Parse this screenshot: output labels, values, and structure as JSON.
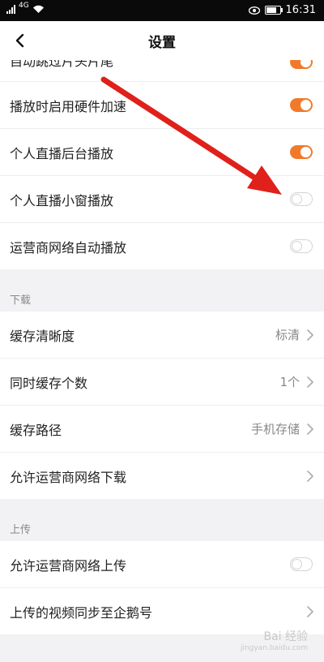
{
  "status_bar": {
    "signal_text": "4G",
    "time": "16:31",
    "icons": [
      "signal-icon",
      "wifi-icon",
      "eye-icon",
      "battery-icon"
    ]
  },
  "nav": {
    "title": "设置",
    "back_icon": "back-arrow-icon"
  },
  "playback": {
    "cut_item": {
      "label": "自动跳过片头片尾",
      "toggle": "on"
    },
    "items": [
      {
        "label": "播放时启用硬件加速",
        "toggle": "on"
      },
      {
        "label": "个人直播后台播放",
        "toggle": "on"
      },
      {
        "label": "个人直播小窗播放",
        "toggle": "off"
      },
      {
        "label": "运营商网络自动播放",
        "toggle": "off"
      }
    ]
  },
  "download": {
    "header": "下载",
    "items": [
      {
        "label": "缓存清晰度",
        "value": "标清"
      },
      {
        "label": "同时缓存个数",
        "value": "1个"
      },
      {
        "label": "缓存路径",
        "value": "手机存储"
      },
      {
        "label": "允许运营商网络下载",
        "value": ""
      }
    ]
  },
  "upload": {
    "header": "上传",
    "items": [
      {
        "label": "允许运营商网络上传",
        "toggle": "off"
      },
      {
        "label": "上传的视频同步至企鹅号",
        "value": ""
      }
    ]
  },
  "colors": {
    "toggle_on": "#f07a2a",
    "annotation_arrow": "#e0201b"
  },
  "watermark": {
    "text": "Bai 经验",
    "sub": "jingyan.baidu.com"
  }
}
